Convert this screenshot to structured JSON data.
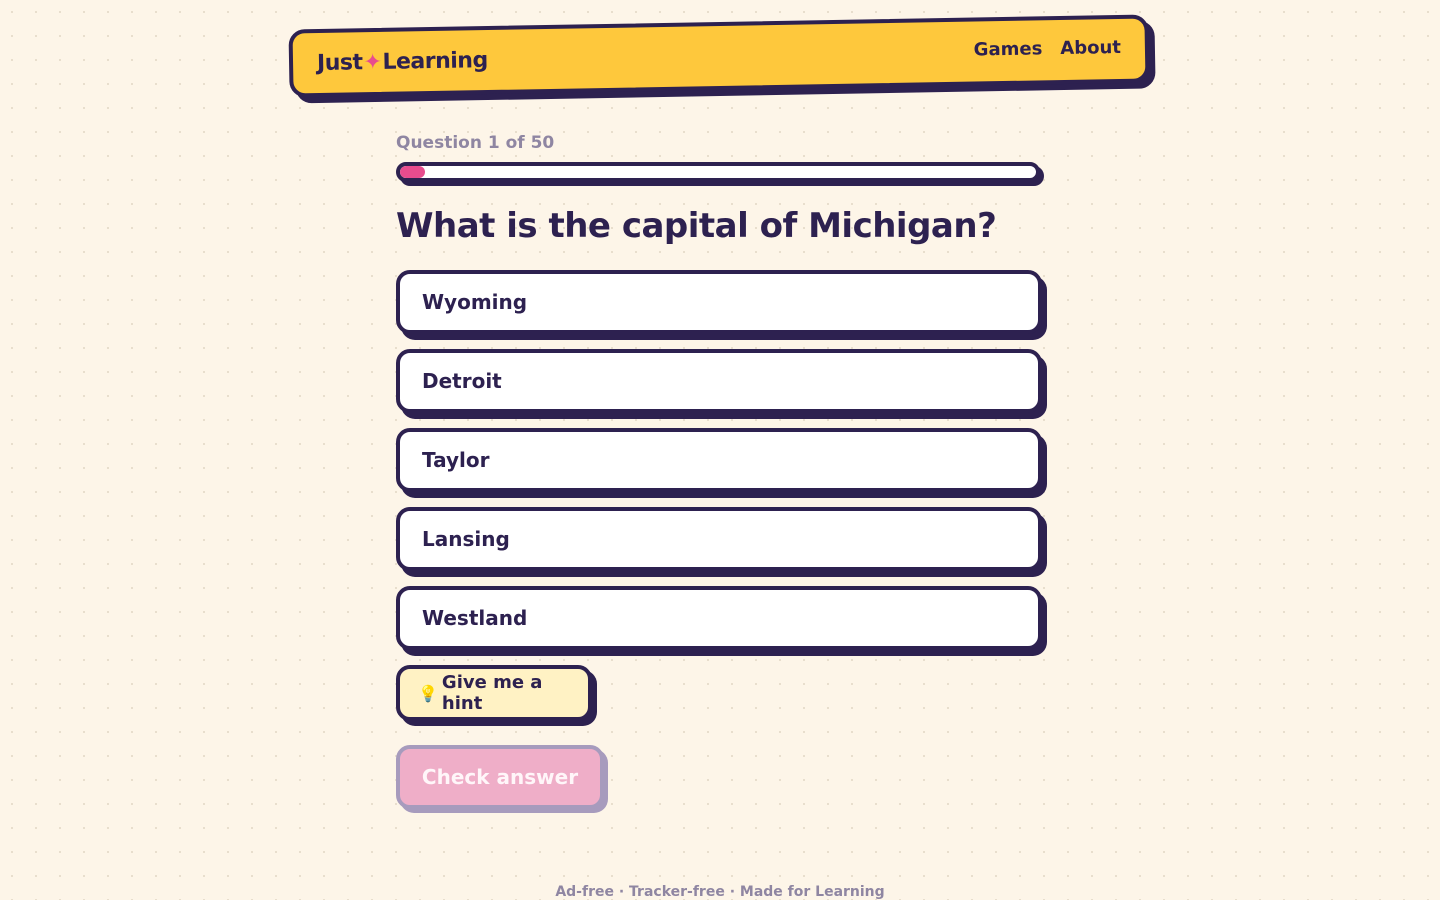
{
  "header": {
    "logo_left": "Just",
    "logo_star": "✦",
    "logo_right": "Learning",
    "nav": [
      {
        "label": "Games"
      },
      {
        "label": "About"
      }
    ]
  },
  "quiz": {
    "progress_label": "Question 1 of 50",
    "progress_fraction": 0.04,
    "question": "What is the capital of Michigan?",
    "options": [
      {
        "label": "Wyoming"
      },
      {
        "label": "Detroit"
      },
      {
        "label": "Taylor"
      },
      {
        "label": "Lansing"
      },
      {
        "label": "Westland"
      }
    ],
    "hint_icon": "💡",
    "hint_label": "Give me a hint",
    "check_label": "Check answer"
  },
  "footer": {
    "text": "Ad-free · Tracker-free · Made for Learning"
  },
  "colors": {
    "background": "#fdf5e8",
    "header": "#fec83c",
    "ink": "#2d2150",
    "accent": "#e84c8e",
    "disabled_button": "#efaec8"
  }
}
